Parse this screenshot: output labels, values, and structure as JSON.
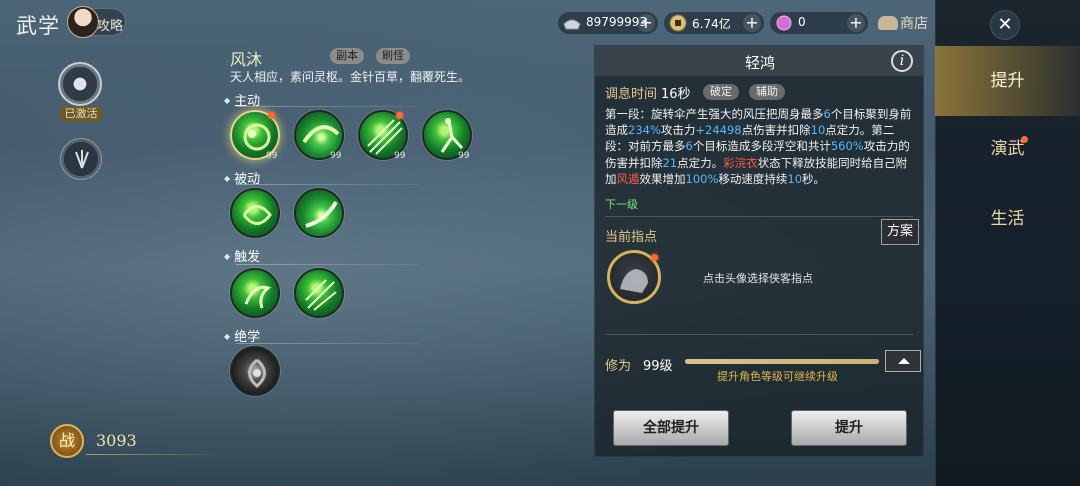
{
  "header": {
    "title": "武学",
    "guide_label": "攻略"
  },
  "currency": {
    "silver": "89799993",
    "coin": "6.74亿",
    "gem": "0",
    "plus": "+",
    "shop_label": "商店"
  },
  "left": {
    "activated_label": "已激活",
    "power_emblem": "战",
    "power_value": "3093"
  },
  "school": {
    "name": "风沐",
    "tags": [
      "副本",
      "刷怪"
    ],
    "motto": "天人相应，素问灵枢。金针百草，翻覆死生。"
  },
  "sections": {
    "active": "主动",
    "passive": "被动",
    "trigger": "触发",
    "ultimate": "绝学"
  },
  "skills": {
    "active": [
      {
        "level": "99",
        "alert": true,
        "selected": true
      },
      {
        "level": "99",
        "alert": false,
        "selected": false
      },
      {
        "level": "99",
        "alert": true,
        "selected": false
      },
      {
        "level": "99",
        "alert": false,
        "selected": false
      }
    ]
  },
  "detail": {
    "title": "轻鸿",
    "info_icon": "i",
    "cooldown_label": "调息时间",
    "cooldown_value": "16秒",
    "tags": [
      "破定",
      "辅助"
    ],
    "desc": {
      "t1": "第一段：旋转伞产生强大的风压把周身最多",
      "n1": "6",
      "t2": "个目标聚到身前造成",
      "n2": "234%",
      "t3": "攻击力",
      "n3": "+24498",
      "t4": "点伤害并扣除",
      "n4": "10",
      "t5": "点定力。第二段：对前方最多",
      "n5": "6",
      "t6": "个目标造成多段浮空和共计",
      "n6": "560%",
      "t7": "攻击力的伤害并扣除",
      "n7": "21",
      "t8": "点定力。",
      "r1": "彩浣衣",
      "t9": "状态下释放技能同时给自己附加",
      "r2": "风遁",
      "t10": "效果增加",
      "n8": "100%",
      "t11": "移动速度持续",
      "n9": "10",
      "t12": "秒。"
    },
    "next_level": "下一级",
    "current_pointer": "当前指点",
    "plan_button": "方案",
    "pointer_hint": "点击头像选择侠客指点",
    "cultivation_label": "修为",
    "cultivation_value": "99级",
    "cultivation_progress": 1.0,
    "cultivation_hint": "提升角色等级可继续升级",
    "btn_all": "全部提升",
    "btn_up": "提升"
  },
  "menu": {
    "close": "✕",
    "items": [
      "提升",
      "演武",
      "生活"
    ],
    "active_index": 0
  },
  "colors": {
    "highlight_blue": "#56b8ff",
    "highlight_red": "#ff5a4a",
    "gold": "#e4c98a"
  }
}
